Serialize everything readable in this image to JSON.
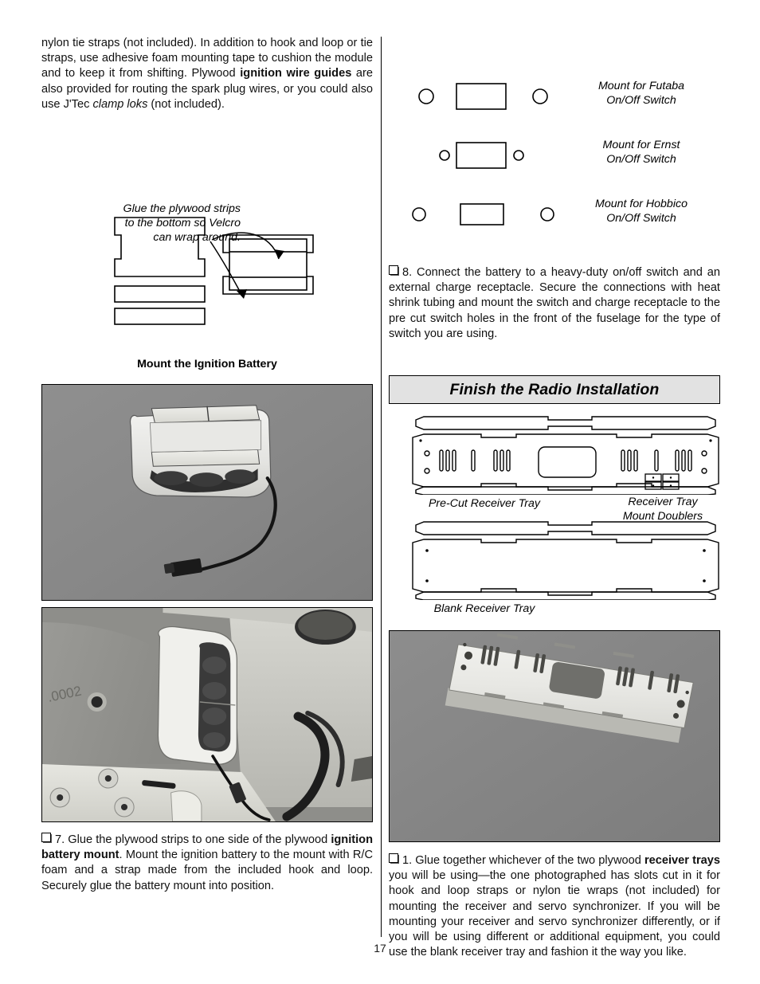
{
  "page": {
    "number": "17"
  },
  "left_column": {
    "intro_paragraph": {
      "part1": "nylon tie straps (not included). In addition to hook and loop or tie straps, use adhesive foam mounting tape to cushion the module and to keep it from shifting. Plywood ",
      "bold1": "ignition wire guides",
      "part2": " are also provided for routing the spark plug wires, or you could also use J'Tec ",
      "italic1": "clamp loks",
      "part3": " (not included)."
    },
    "glue_note": {
      "line1": "Glue the plywood strips",
      "line2": "to the bottom so Velcro",
      "line3": "can wrap around."
    },
    "battery_figure_caption": "Mount the Ignition Battery",
    "photo_battery_alt": "ignition battery with foam mount and lead wire",
    "photo_installed_alt": "ignition battery mounted inside fuselage",
    "step7": {
      "number": "7.",
      "part1": " Glue the plywood strips to one side of the plywood ",
      "bold1": "ignition battery mount",
      "part2": ". Mount the ignition battery to the mount with R/C foam and a strap made from the included hook and loop. Securely glue the battery mount into position."
    }
  },
  "right_column": {
    "switch_mounts": [
      {
        "label_line1": "Mount for Futaba",
        "label_line2": "On/Off Switch",
        "hole_size": "large"
      },
      {
        "label_line1": "Mount for Ernst",
        "label_line2": "On/Off Switch",
        "hole_size": "small"
      },
      {
        "label_line1": "Mount for Hobbico",
        "label_line2": "On/Off Switch",
        "hole_size": "medium"
      }
    ],
    "step8": {
      "number": "8.",
      "text": " Connect the battery to a heavy-duty on/off switch and an external charge receptacle. Secure the connections with heat shrink tubing and mount the switch and charge receptacle to the pre cut switch holes in the front of the fuselage for the type of switch you are using."
    },
    "section_title": "Finish the Radio Installation",
    "precut_tray_caption": "Pre-Cut Receiver Tray",
    "doublers_caption_line1": "Receiver Tray",
    "doublers_caption_line2": "Mount Doublers",
    "blank_tray_caption": "Blank Receiver Tray",
    "photo_tray_alt": "pre-cut plywood receiver tray with slots",
    "step1": {
      "number": "1.",
      "part1": " Glue together whichever of the two plywood ",
      "bold1": "receiver trays",
      "part2": " you will be using—the one photographed has slots cut in it for hook and loop straps or nylon tie wraps (not included) for mounting the receiver and servo synchronizer. If you will be mounting your receiver and servo synchronizer differently, or if you will be using different or additional equipment, you could use the blank receiver tray and fashion it the way you like."
    }
  }
}
